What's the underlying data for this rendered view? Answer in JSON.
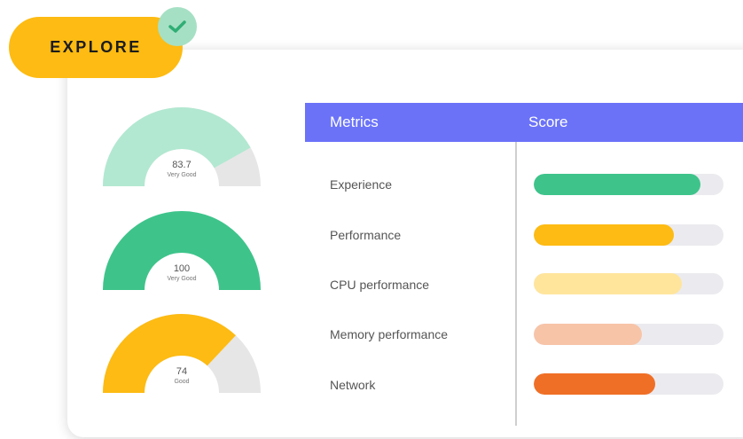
{
  "badge": {
    "label": "EXPLORE",
    "icon": "check-icon"
  },
  "gauges": [
    {
      "value": "83.7",
      "label": "Very Good",
      "fraction": 0.837,
      "color": "#b2e8d1",
      "track": "#e6e6e6"
    },
    {
      "value": "100",
      "label": "Very Good",
      "fraction": 1.0,
      "color": "#3ec48b",
      "track": "#e6e6e6"
    },
    {
      "value": "74",
      "label": "Good",
      "fraction": 0.74,
      "color": "#fdbb13",
      "track": "#e6e6e6"
    }
  ],
  "table": {
    "headers": {
      "metrics": "Metrics",
      "score": "Score"
    },
    "rows": [
      {
        "metric": "Experience",
        "score": 0.88,
        "color": "#3ec48b"
      },
      {
        "metric": "Performance",
        "score": 0.74,
        "color": "#fdbb13"
      },
      {
        "metric": "CPU performance",
        "score": 0.78,
        "color": "#ffe59c"
      },
      {
        "metric": "Memory performance",
        "score": 0.57,
        "color": "#f7c4a8"
      },
      {
        "metric": "Network",
        "score": 0.64,
        "color": "#f06f26"
      }
    ]
  }
}
